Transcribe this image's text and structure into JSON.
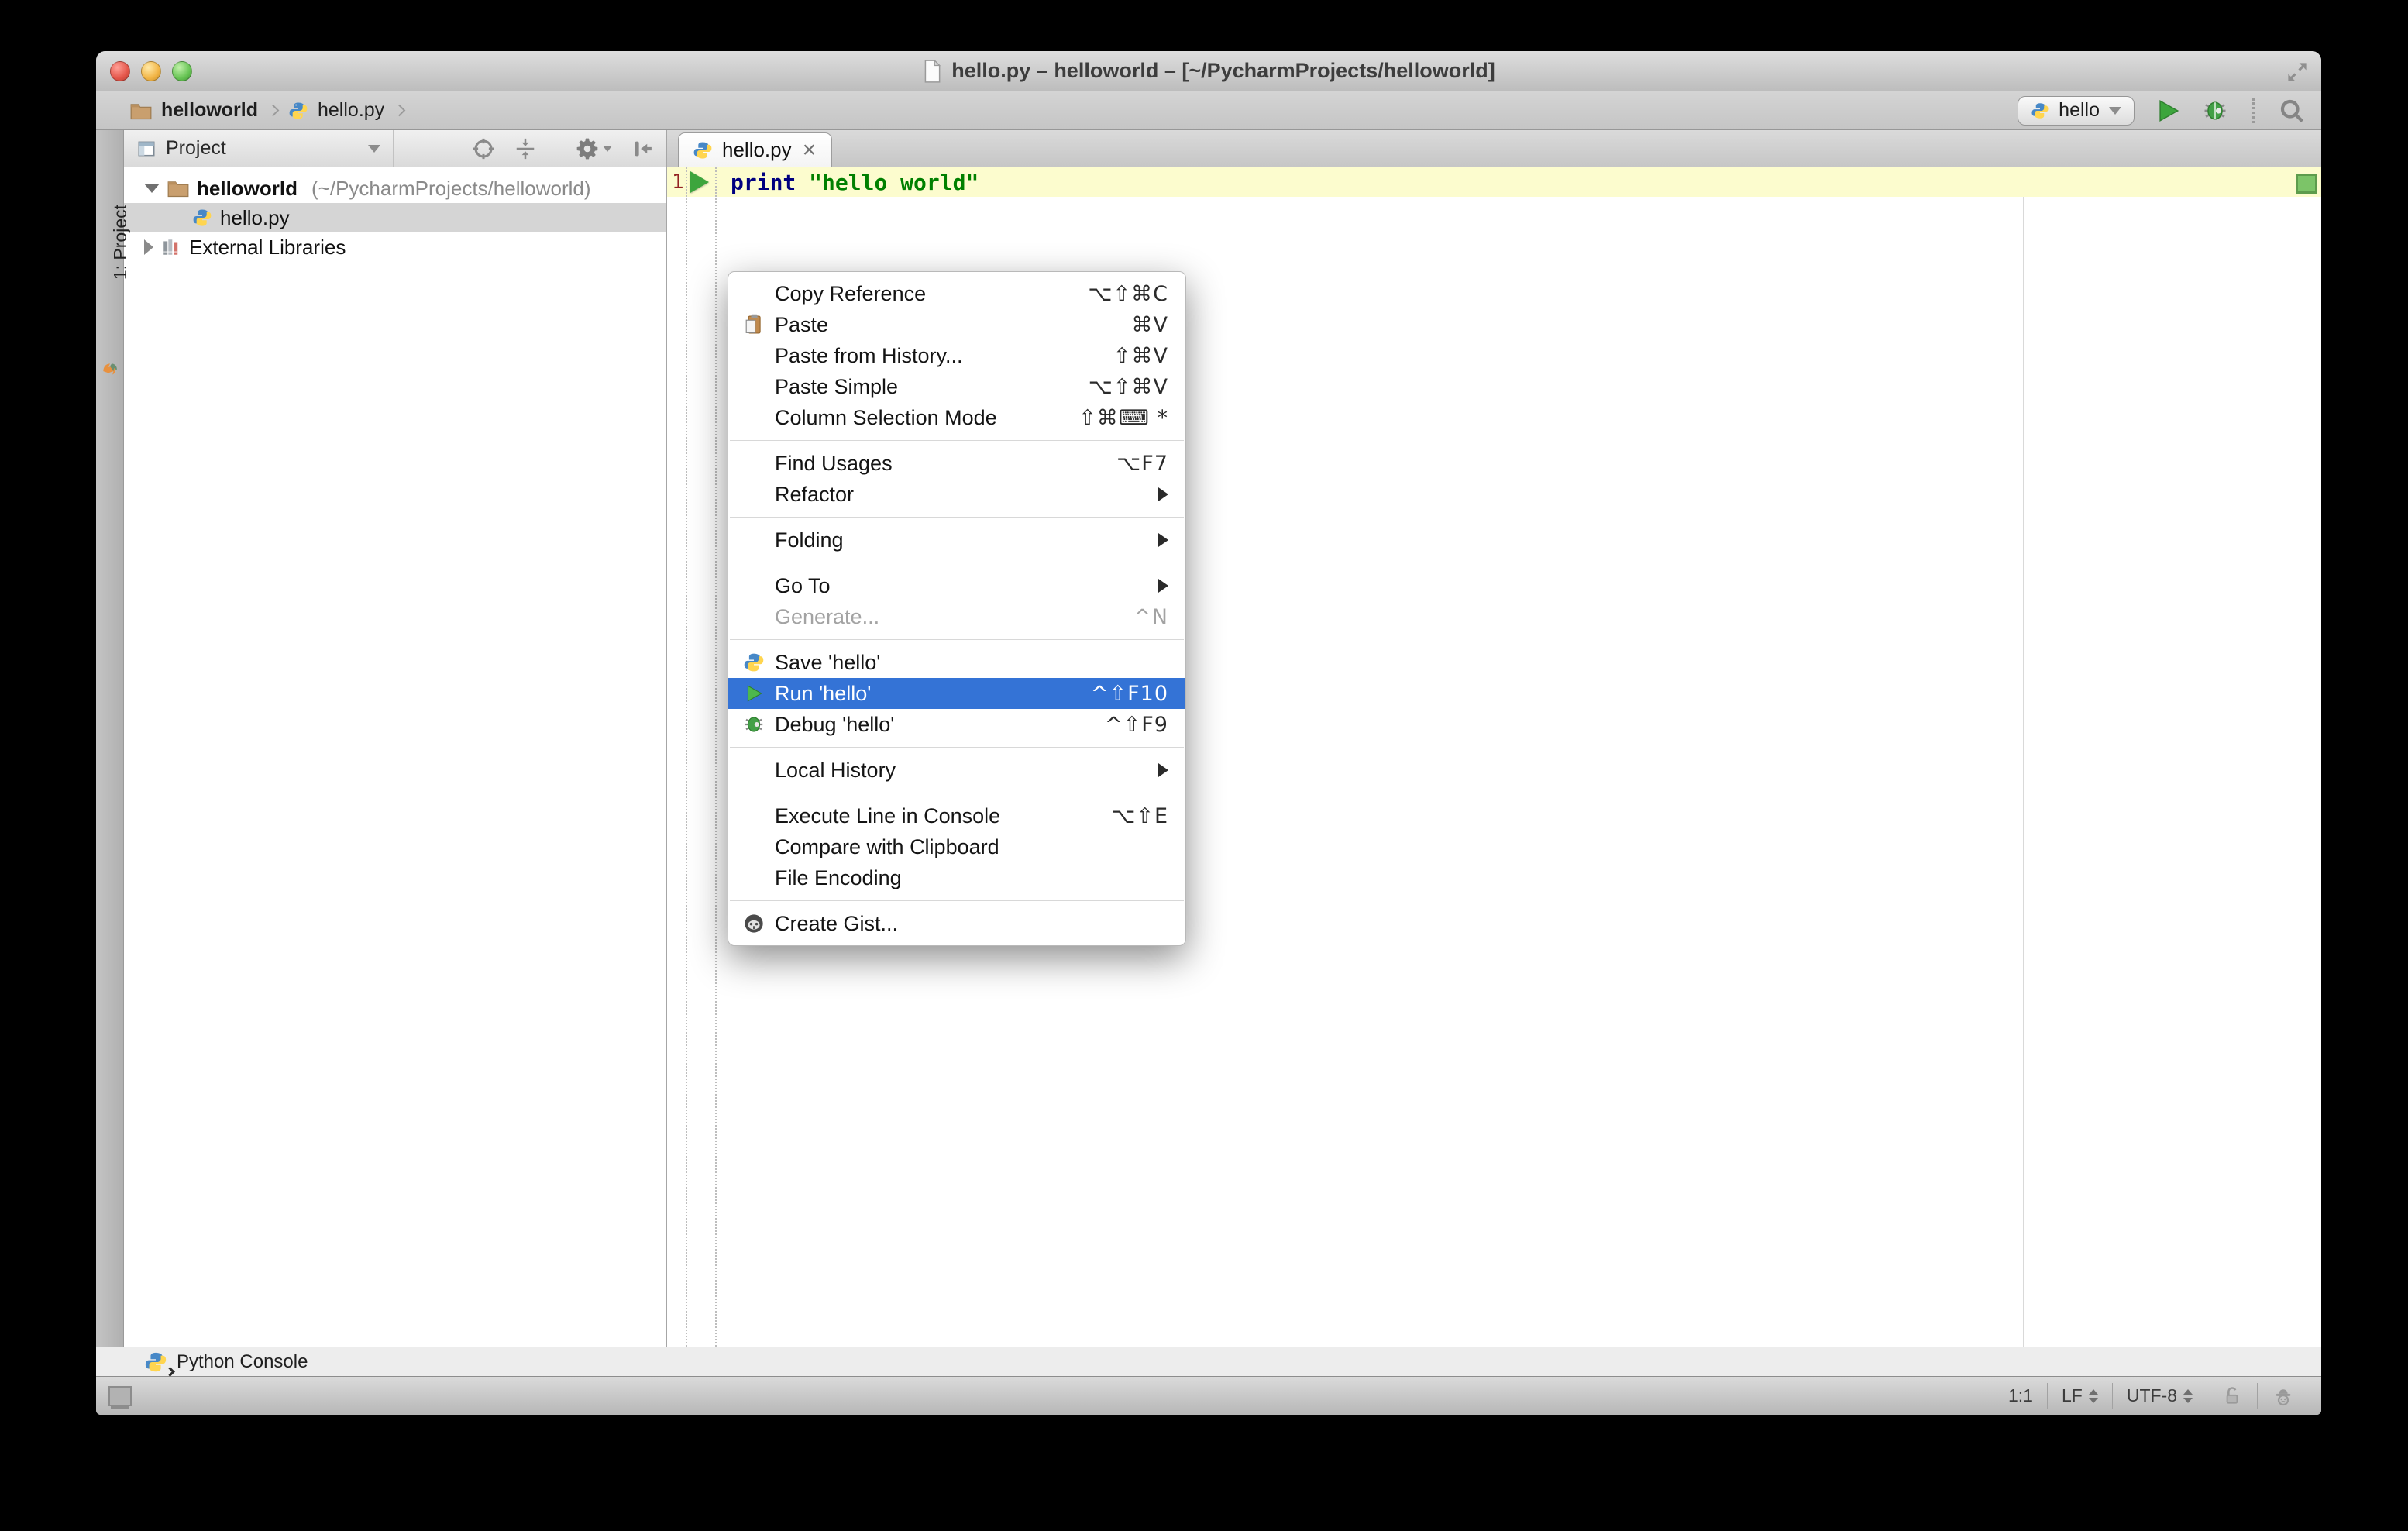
{
  "window": {
    "title": "hello.py – helloworld – [~/PycharmProjects/helloworld]"
  },
  "toolbar": {
    "breadcrumbs": [
      {
        "label": "helloworld"
      },
      {
        "label": "hello.py"
      }
    ],
    "run_config": {
      "label": "hello"
    }
  },
  "project_panel": {
    "stripe_label": "1: Project",
    "header": {
      "title": "Project"
    },
    "tree": [
      {
        "label": "helloworld",
        "path": "(~/PycharmProjects/helloworld)",
        "state": "expanded"
      },
      {
        "label": "hello.py",
        "state": "selected"
      },
      {
        "label": "External Libraries",
        "state": "collapsed"
      }
    ]
  },
  "editor": {
    "tab": {
      "label": "hello.py",
      "close_label": "×"
    },
    "line_number": "1",
    "code": {
      "keyword": "print",
      "string": "\"hello world\""
    }
  },
  "context_menu": {
    "items": [
      {
        "label": "Copy Reference",
        "shortcut": "⌥⇧⌘C"
      },
      {
        "label": "Paste",
        "shortcut": "⌘V",
        "icon": "clipboard"
      },
      {
        "label": "Paste from History...",
        "shortcut": "⇧⌘V"
      },
      {
        "label": "Paste Simple",
        "shortcut": "⌥⇧⌘V"
      },
      {
        "label": "Column Selection Mode",
        "shortcut": "⇧⌘⌨ *"
      },
      {
        "label": "Find Usages",
        "shortcut": "⌥F7"
      },
      {
        "label": "Refactor",
        "submenu": true
      },
      {
        "label": "Folding",
        "submenu": true
      },
      {
        "label": "Go To",
        "submenu": true
      },
      {
        "label": "Generate...",
        "shortcut": "^N",
        "state": "disabled"
      },
      {
        "label": "Save 'hello'",
        "icon": "python"
      },
      {
        "label": "Run 'hello'",
        "shortcut": "^⇧F10",
        "icon": "run",
        "state": "highlighted"
      },
      {
        "label": "Debug 'hello'",
        "shortcut": "^⇧F9",
        "icon": "debug"
      },
      {
        "label": "Local History",
        "submenu": true
      },
      {
        "label": "Execute Line in Console",
        "shortcut": "⌥⇧E"
      },
      {
        "label": "Compare with Clipboard"
      },
      {
        "label": "File Encoding"
      },
      {
        "label": "Create Gist...",
        "icon": "github"
      }
    ]
  },
  "bottom_bar": {
    "python_console_label": "Python Console"
  },
  "status_bar": {
    "caret_position": "1:1",
    "line_separator": "LF",
    "encoding": "UTF-8"
  },
  "colors": {
    "menu_highlight": "#3473d6",
    "run_green": "#3da53d",
    "current_line_highlight": "#fcfcce",
    "keyword": "#000080",
    "string": "#008000"
  }
}
